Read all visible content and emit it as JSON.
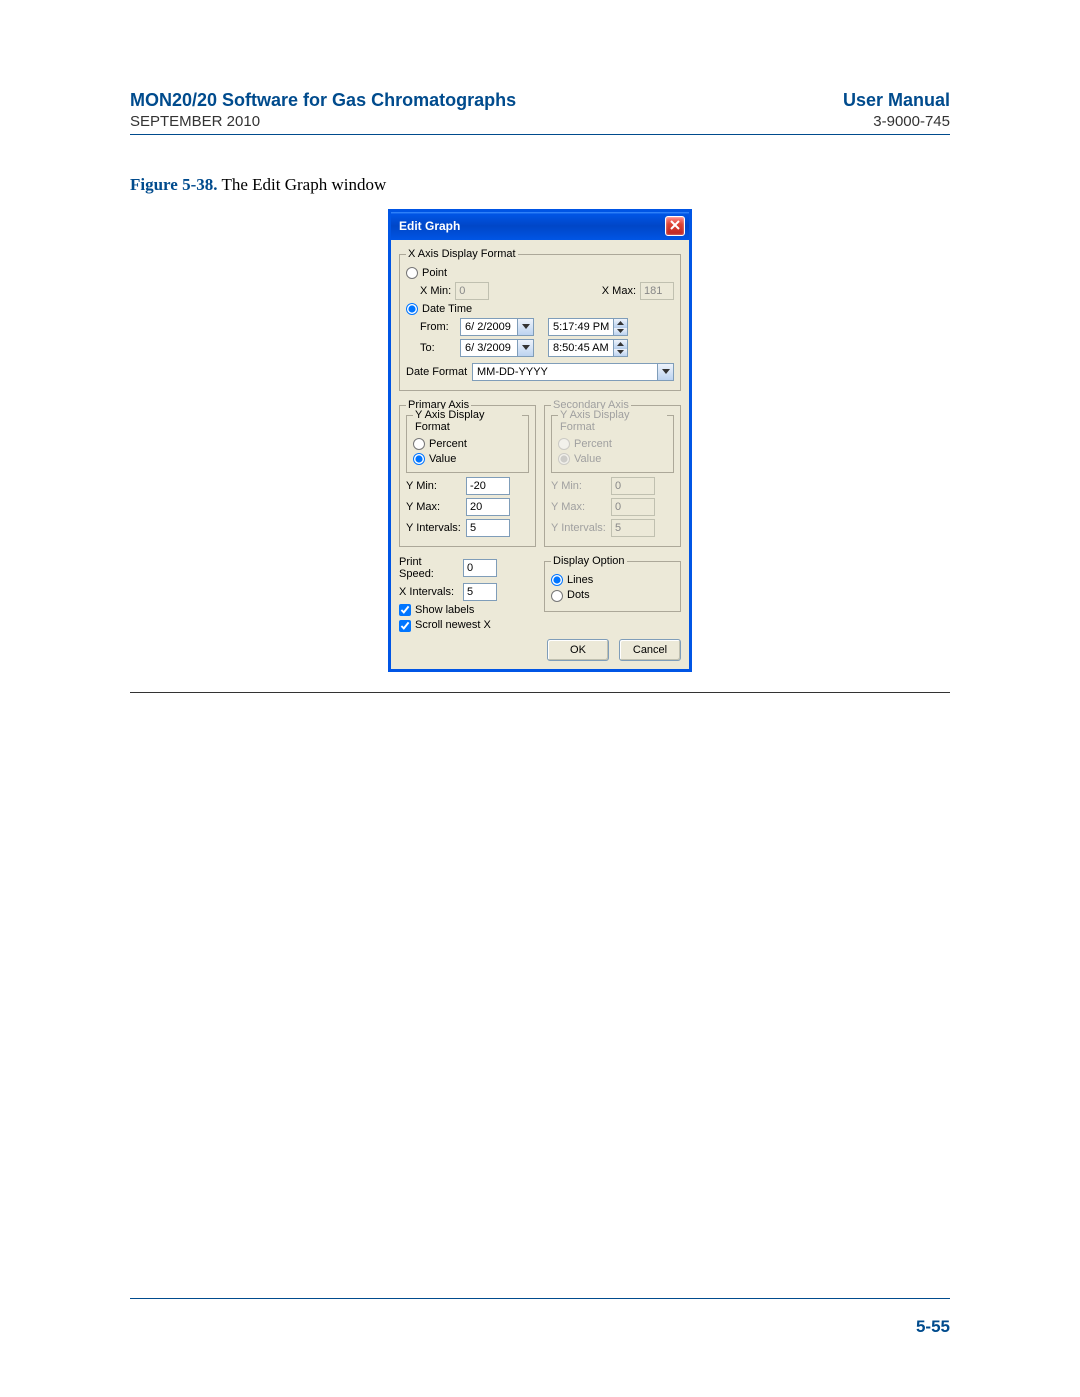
{
  "header": {
    "title": "MON20/20 Software for Gas Chromatographs",
    "manual": "User Manual",
    "date": "SEPTEMBER 2010",
    "docnum": "3-9000-745"
  },
  "figure": {
    "number": "Figure 5-38.",
    "caption": "The Edit Graph window"
  },
  "dialog": {
    "title": "Edit Graph",
    "close_label": "Close",
    "xaxis": {
      "legend": "X Axis Display Format",
      "point_label": "Point",
      "xmin_label": "X Min:",
      "xmin_value": "0",
      "xmax_label": "X Max:",
      "xmax_value": "181",
      "datetime_label": "Date Time",
      "from_label": "From:",
      "from_date": "6/ 2/2009",
      "from_time": "5:17:49 PM",
      "to_label": "To:",
      "to_date": "6/ 3/2009",
      "to_time": "8:50:45 AM",
      "dateformat_label": "Date Format",
      "dateformat_value": "MM-DD-YYYY"
    },
    "primary": {
      "legend": "Primary Axis",
      "yaxis_legend": "Y Axis Display Format",
      "percent_label": "Percent",
      "value_label": "Value",
      "ymin_label": "Y Min:",
      "ymin_value": "-20",
      "ymax_label": "Y Max:",
      "ymax_value": "20",
      "yint_label": "Y Intervals:",
      "yint_value": "5"
    },
    "secondary": {
      "legend": "Secondary Axis",
      "yaxis_legend": "Y Axis Display Format",
      "percent_label": "Percent",
      "value_label": "Value",
      "ymin_label": "Y Min:",
      "ymin_value": "0",
      "ymax_label": "Y Max:",
      "ymax_value": "0",
      "yint_label": "Y Intervals:",
      "yint_value": "5"
    },
    "display": {
      "legend": "Display Option",
      "lines_label": "Lines",
      "dots_label": "Dots"
    },
    "other": {
      "printspeed_label": "Print Speed:",
      "printspeed_value": "0",
      "xintervals_label": "X Intervals:",
      "xintervals_value": "5",
      "showlabels_label": "Show labels",
      "scrollnewest_label": "Scroll newest X"
    },
    "buttons": {
      "ok": "OK",
      "cancel": "Cancel"
    }
  },
  "footer": {
    "pagenum": "5-55"
  }
}
